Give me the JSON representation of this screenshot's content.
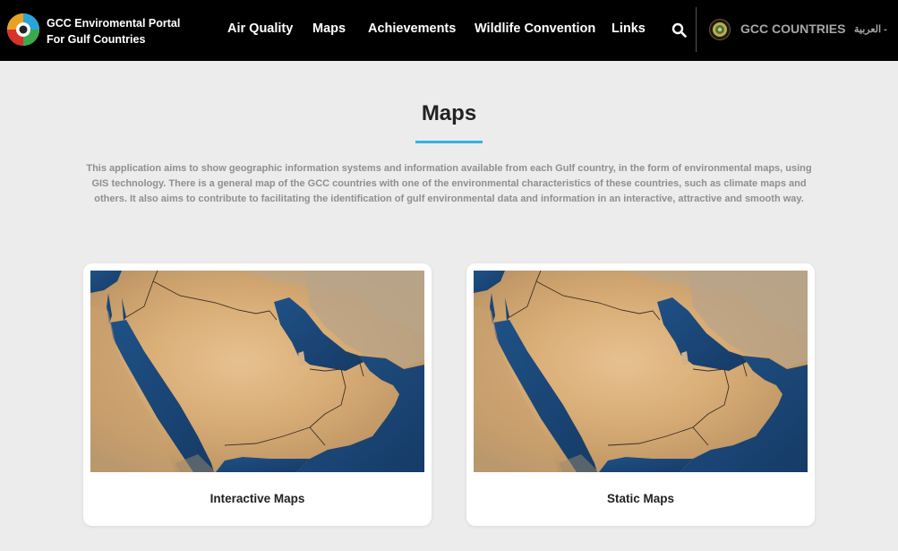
{
  "header": {
    "brand_line1": "GCC Enviromental Portal",
    "brand_line2": "For Gulf Countries",
    "nav": [
      "Air Quality",
      "Maps",
      "Achievements",
      "Wildlife Convention",
      "Links"
    ],
    "search_icon": "search-icon",
    "gcc_label": "GCC COUNTRIES",
    "language_label": "العربية -"
  },
  "main": {
    "title": "Maps",
    "intro_line1": "This application aims to show geographic information systems and information available from each Gulf country, in the form of environmental maps, using",
    "intro_line2": "GIS technology. There is a general map of the GCC countries with one of the environmental characteristics of these countries, such as climate maps and",
    "intro_line3": "others. It also aims to contribute to facilitating the identification of gulf environmental data and information in an interactive, attractive and smooth way."
  },
  "cards": [
    {
      "label": "Interactive Maps"
    },
    {
      "label": "Static Maps"
    }
  ],
  "colors": {
    "header_bg": "#000000",
    "page_bg": "#ececec",
    "accent": "#34b3e0",
    "sea": "#1d4a7a",
    "desert": "#d9b27c"
  }
}
